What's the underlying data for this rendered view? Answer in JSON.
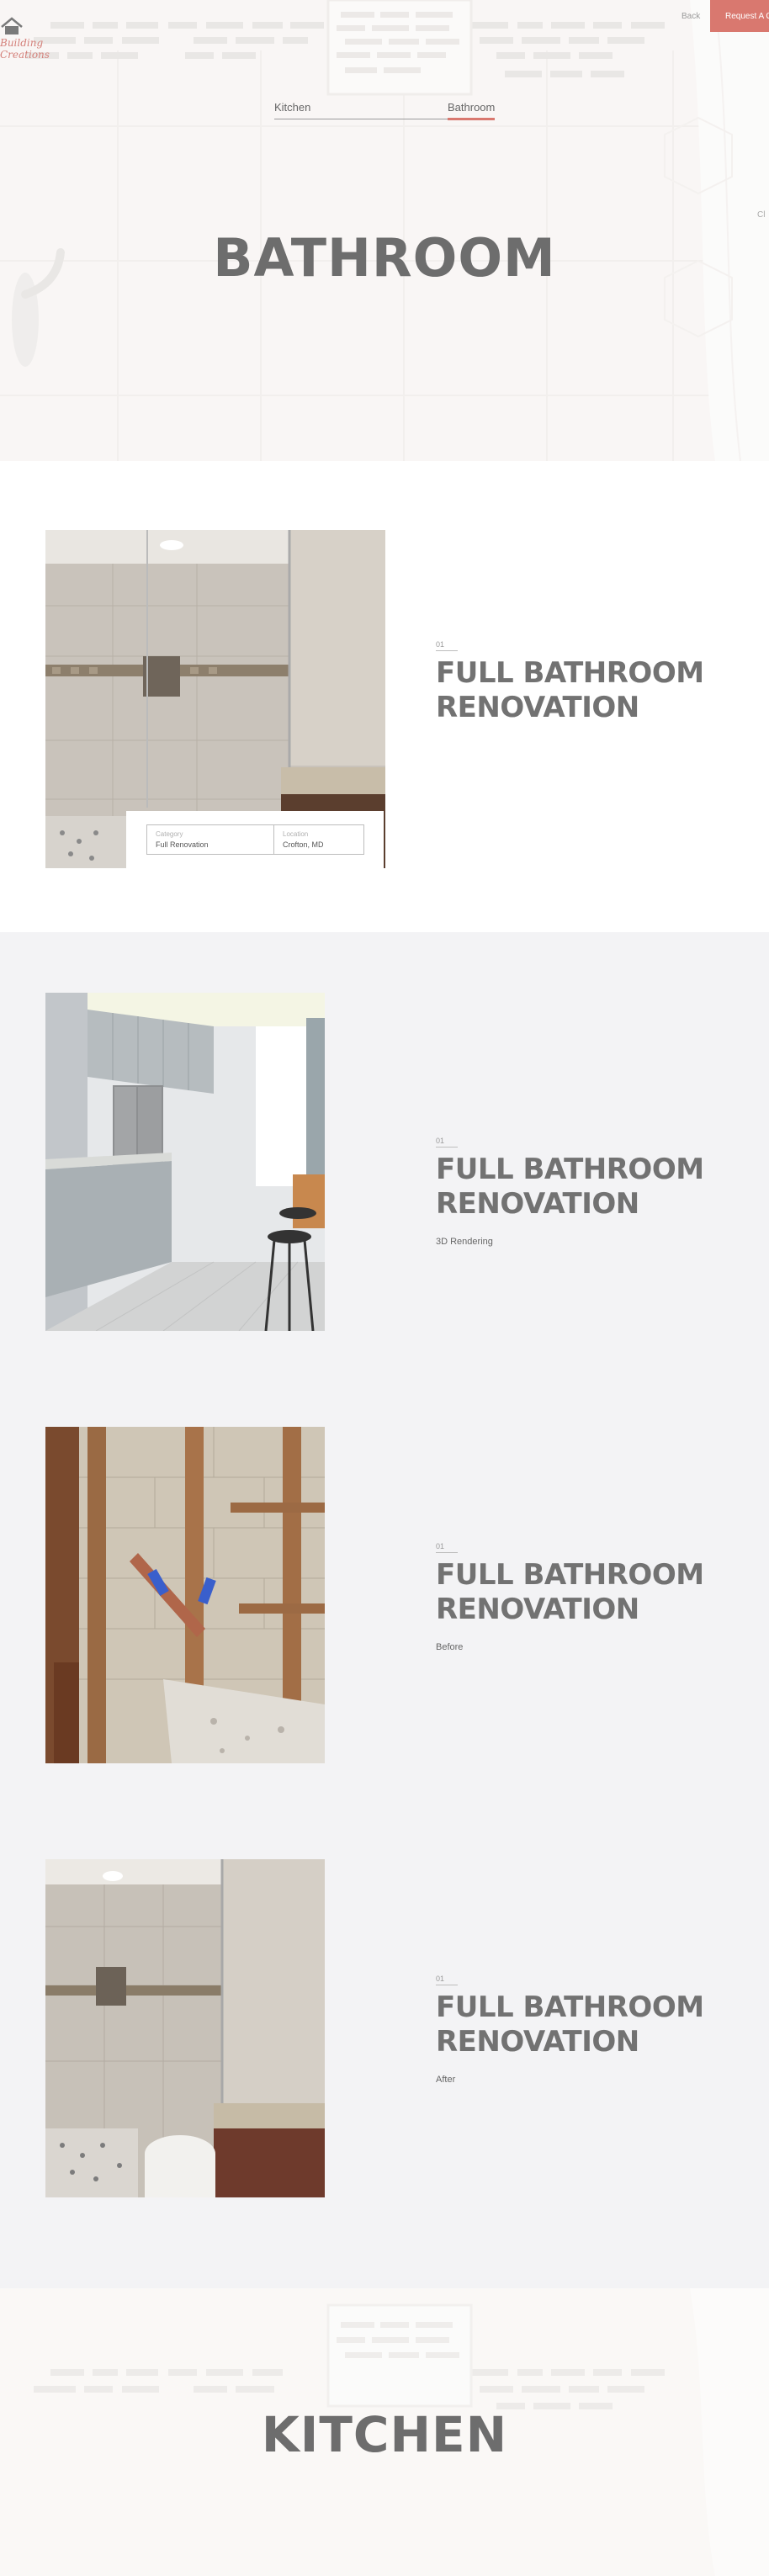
{
  "header": {
    "logo_text_line1": "Building",
    "logo_text_line2": "Creations",
    "nav_link": "Back",
    "quote_button": "Request A Quote"
  },
  "category_nav": {
    "tabs": [
      {
        "label": "Kitchen",
        "active": false
      },
      {
        "label": "Bathroom",
        "active": true
      }
    ]
  },
  "hero": {
    "title": "BATHROOM",
    "side_tag": "Cl"
  },
  "projects": [
    {
      "number": "01",
      "title_line1": "FULL BATHROOM",
      "title_line2": "RENOVATION",
      "subtitle": "",
      "image": "shower-photo",
      "details": {
        "project_label": "Category",
        "project_value": "Full Renovation",
        "location_label": "Location",
        "location_value": "Crofton, MD"
      }
    },
    {
      "number": "01",
      "title_line1": "FULL BATHROOM",
      "title_line2": "RENOVATION",
      "subtitle": "3D Rendering",
      "image": "kitchen-render"
    },
    {
      "number": "01",
      "title_line1": "FULL BATHROOM",
      "title_line2": "RENOVATION",
      "subtitle": "Before",
      "image": "demolition-photo"
    },
    {
      "number": "01",
      "title_line1": "FULL BATHROOM",
      "title_line2": "RENOVATION",
      "subtitle": "After",
      "image": "finished-bathroom-photo"
    }
  ],
  "next_section": {
    "title": "KITCHEN"
  },
  "colors": {
    "accent": "#d9786f",
    "heading": "#6d6d6d",
    "grey_section": "#f3f3f5"
  }
}
